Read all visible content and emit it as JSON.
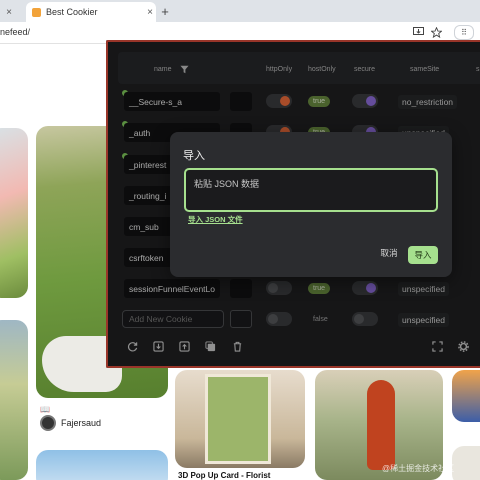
{
  "browser": {
    "left_tab_close": "×",
    "active_tab": {
      "title": "Best Cookier",
      "close": "×"
    },
    "new_tab": "+",
    "url": "nefeed/",
    "ext_icon": "⠿"
  },
  "page": {
    "creator_name": "Fajersaud",
    "pin_title": "3D Pop Up Card - Florist",
    "book_icon": "📖",
    "watermark": "@稀土掘金技术社区"
  },
  "extension": {
    "columns": {
      "name": "name",
      "httpOnly": "httpOnly",
      "hostOnly": "hostOnly",
      "secure": "secure",
      "sameSite": "sameSite",
      "overflow": "s"
    },
    "rows": [
      {
        "name": "__Secure-s_a",
        "host_pill": "true",
        "samesite": "no_restriction"
      },
      {
        "name": "_auth",
        "host_pill": "true",
        "samesite": "unspecified"
      },
      {
        "name": "_pinterest",
        "host_pill": "",
        "samesite": ""
      },
      {
        "name": "_routing_i",
        "host_pill": "",
        "samesite": ""
      },
      {
        "name": "cm_sub",
        "host_pill": "",
        "samesite": ""
      },
      {
        "name": "csrftoken",
        "host_pill": "",
        "samesite": ""
      },
      {
        "name": "sessionFunnelEventLo",
        "host_pill": "true",
        "samesite": "unspecified"
      }
    ],
    "new_row": {
      "placeholder": "Add New Cookie",
      "host_pill": "false",
      "samesite": "unspecified"
    }
  },
  "dialog": {
    "title": "导入",
    "placeholder": "粘贴 JSON 数据",
    "import_file_link": "导入 JSON 文件",
    "cancel": "取消",
    "confirm": "导入"
  },
  "colors": {
    "accent_green": "#a6e08e",
    "popup_border": "#d44a3a",
    "toggle_orange": "#e96a3a",
    "toggle_purple": "#8d6bd8"
  }
}
